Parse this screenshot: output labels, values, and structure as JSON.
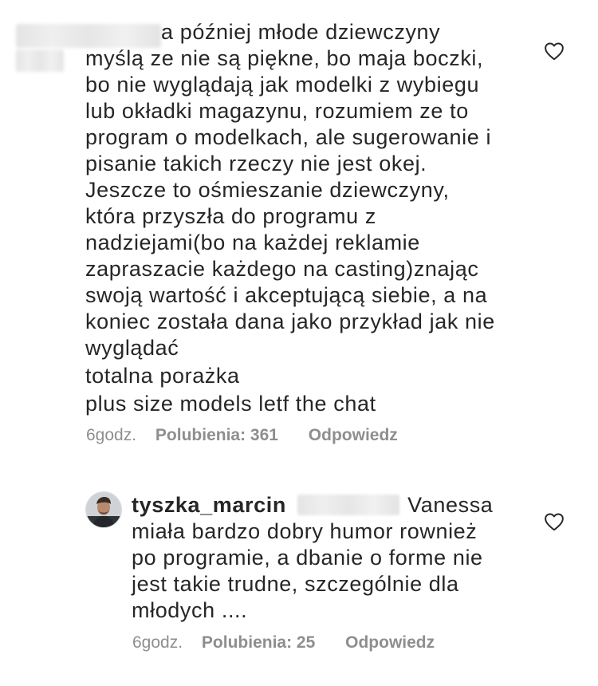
{
  "comment1": {
    "lines": [
      "a później młode dziewczyny",
      "myślą ze nie są piękne, bo maja boczki,",
      "bo nie wyglądają jak modelki z wybiegu",
      "lub okładki magazynu, rozumiem ze to",
      "program o modelkach, ale sugerowanie i",
      "pisanie takich rzeczy nie jest okej.",
      "Jeszcze to ośmieszanie dziewczyny,",
      "która przyszła do programu z",
      "nadziejami(bo na każdej reklamie",
      "zapraszacie każdego na casting)znając",
      "swoją wartość i akceptującą siebie, a na",
      "koniec została dana jako przykład jak nie",
      "wyglądać",
      "totalna porażka",
      "plus size models letf the chat"
    ],
    "time": "6godz.",
    "likes": "Polubienia: 361",
    "reply": "Odpowiedz"
  },
  "comment2": {
    "username": "tyszka_marcin",
    "lines": [
      "Vanessa",
      "miała bardzo dobry humor rownież",
      "po programie, a dbanie o forme nie",
      "jest takie trudne, szczególnie dla",
      "młodych ...."
    ],
    "time": "6godz.",
    "likes": "Polubienia: 25",
    "reply": "Odpowiedz"
  },
  "icons": {
    "like": "heart-icon"
  },
  "colors": {
    "text": "#262626",
    "meta": "#8e8e8e"
  }
}
